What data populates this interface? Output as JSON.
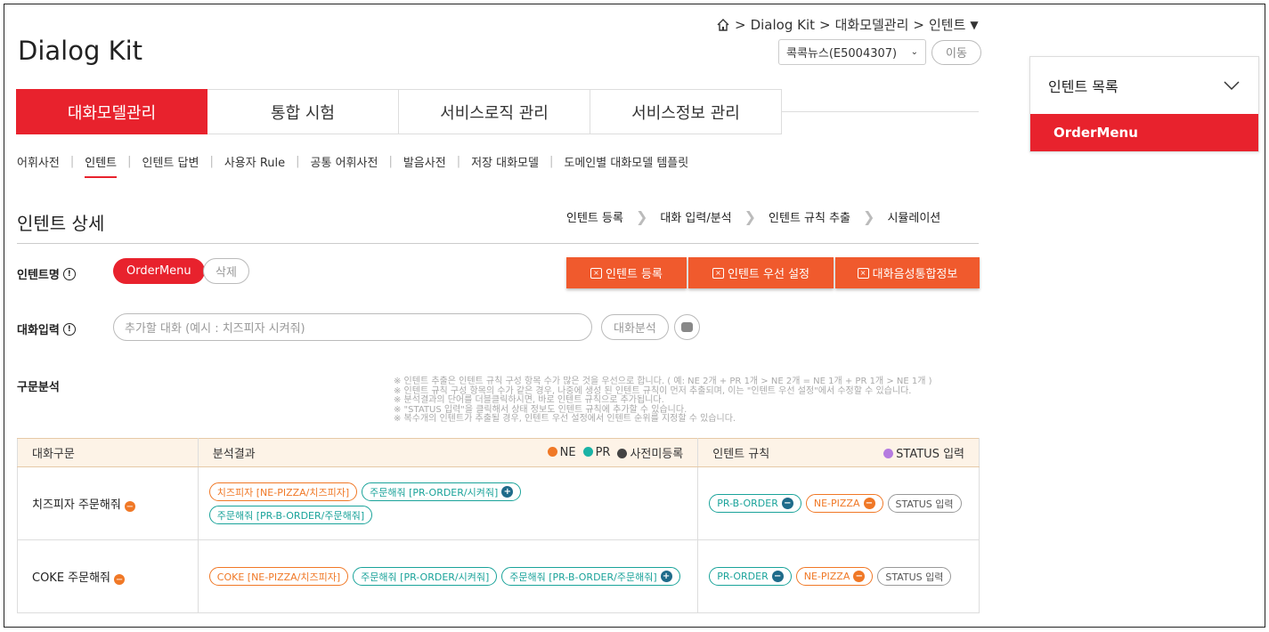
{
  "breadcrumb": {
    "home_icon": "home-icon",
    "items": [
      "Dialog Kit",
      "대화모델관리",
      "인텐트"
    ],
    "sep": ">",
    "dropdown": "▼"
  },
  "app_title": "Dialog Kit",
  "selector": {
    "value": "콕콕뉴스(E5004307)",
    "move_label": "이동"
  },
  "tabs": [
    {
      "label": "대화모델관리",
      "active": true
    },
    {
      "label": "통합 시험",
      "active": false
    },
    {
      "label": "서비스로직 관리",
      "active": false
    },
    {
      "label": "서비스정보 관리",
      "active": false
    }
  ],
  "subnav": [
    "어휘사전",
    "인텐트",
    "인텐트 답변",
    "사용자 Rule",
    "공통 어휘사전",
    "발음사전",
    "저장 대화모델",
    "도메인별 대화모델 템플릿"
  ],
  "section_title": "인텐트 상세",
  "steps": [
    "인텐트 등록",
    "대화 입력/분석",
    "인텐트 규칙 추출",
    "시뮬레이션"
  ],
  "intent_name": {
    "label": "인텐트명",
    "value": "OrderMenu",
    "delete_label": "삭제"
  },
  "actions": [
    "인텐트 등록",
    "인텐트 우선 설정",
    "대화음성통합정보"
  ],
  "dialog_input": {
    "label": "대화입력",
    "placeholder": "추가할 대화 (예시 : 치즈피자 시켜줘)",
    "analyze_label": "대화분석"
  },
  "parse": {
    "label": "구문분석",
    "notes": [
      "※ 인텐트 추출은 인텐트 규칙 구성 항목 수가 많은 것을 우선으로 합니다. ( 예: NE 2개 + PR 1개 > NE 2개 = NE 1개 + PR 1개 > NE 1개 )",
      "※ 인텐트 규칙 구성 항목의 수가 같은 경우, 나중에 생성 된 인텐트 규칙이 먼저 추출되며, 이는 \"인텐트 우선 설정\"에서 수정할 수 있습니다.",
      "※ 분석결과의 단어를 더블클릭하시면, 바로 인텐트 규칙으로 추가됩니다.",
      "※ \"STATUS 입력\"을 클릭해서 상태 정보도 인텐트 규칙에 추가할 수 있습니다.",
      "※ 복수개의 인텐트가 추출될 경우, 인텐트 우선 설정에서 인텐트 순위를 지정할 수 있습니다."
    ]
  },
  "table": {
    "headers": {
      "utterance": "대화구문",
      "result": "분석결과",
      "rule": "인텐트 규칙"
    },
    "legend": [
      {
        "label": "NE",
        "color": "#f07826"
      },
      {
        "label": "PR",
        "color": "#1ab3a6"
      },
      {
        "label": "사전미등록",
        "color": "#444444"
      }
    ],
    "status_legend": {
      "label": "STATUS 입력",
      "color": "#b57be0"
    },
    "rows": [
      {
        "utterance": "치즈피자 주문해줘",
        "result_tags": [
          {
            "text": "치즈피자 [NE-PIZZA/치즈피자]",
            "kind": "ne",
            "icon": ""
          },
          {
            "text": "주문해줘 [PR-ORDER/시켜줘]",
            "kind": "pr",
            "icon": "+"
          },
          {
            "text": "주문해줘 [PR-B-ORDER/주문해줘]",
            "kind": "pr",
            "icon": ""
          }
        ],
        "rule_tags": [
          {
            "text": "PR-B-ORDER",
            "kind": "pr",
            "icon": "−"
          },
          {
            "text": "NE-PIZZA",
            "kind": "ne",
            "icon": "−"
          },
          {
            "text": "STATUS 입력",
            "kind": "st",
            "icon": ""
          }
        ]
      },
      {
        "utterance": "COKE 주문해줘",
        "result_tags": [
          {
            "text": "COKE [NE-PIZZA/치즈피자]",
            "kind": "ne",
            "icon": ""
          },
          {
            "text": "주문해줘 [PR-ORDER/시켜줘]",
            "kind": "pr",
            "icon": ""
          },
          {
            "text": "주문해줘 [PR-B-ORDER/주문해줘]",
            "kind": "pr",
            "icon": "+"
          }
        ],
        "rule_tags": [
          {
            "text": "PR-ORDER",
            "kind": "pr",
            "icon": "−"
          },
          {
            "text": "NE-PIZZA",
            "kind": "ne",
            "icon": "−"
          },
          {
            "text": "STATUS 입력",
            "kind": "st",
            "icon": ""
          }
        ]
      }
    ]
  },
  "intent_list": {
    "title": "인텐트 목록",
    "items": [
      "OrderMenu"
    ]
  },
  "colors": {
    "accent": "#e8222d",
    "action": "#f05a2d",
    "ne": "#f07826",
    "pr": "#1aa39a"
  }
}
